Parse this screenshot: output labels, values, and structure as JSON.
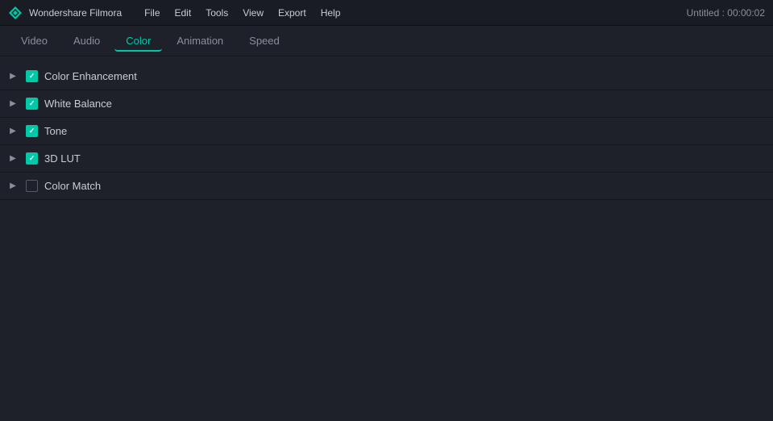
{
  "titlebar": {
    "app_name": "Wondershare Filmora",
    "title": "Untitled : 00:00:02",
    "menus": [
      "File",
      "Edit",
      "Tools",
      "View",
      "Export",
      "Help"
    ]
  },
  "tabs": [
    {
      "label": "Video",
      "active": false
    },
    {
      "label": "Audio",
      "active": false
    },
    {
      "label": "Color",
      "active": true
    },
    {
      "label": "Animation",
      "active": false
    },
    {
      "label": "Speed",
      "active": false
    }
  ],
  "sections": [
    {
      "label": "Color Enhancement",
      "checked": true,
      "expanded": false
    },
    {
      "label": "White Balance",
      "checked": true,
      "expanded": false
    },
    {
      "label": "Tone",
      "checked": true,
      "expanded": false
    },
    {
      "label": "3D LUT",
      "checked": true,
      "expanded": false
    },
    {
      "label": "Color Match",
      "checked": false,
      "expanded": false
    }
  ],
  "icons": {
    "chevron_right": "▶",
    "checkmark": "✓"
  }
}
